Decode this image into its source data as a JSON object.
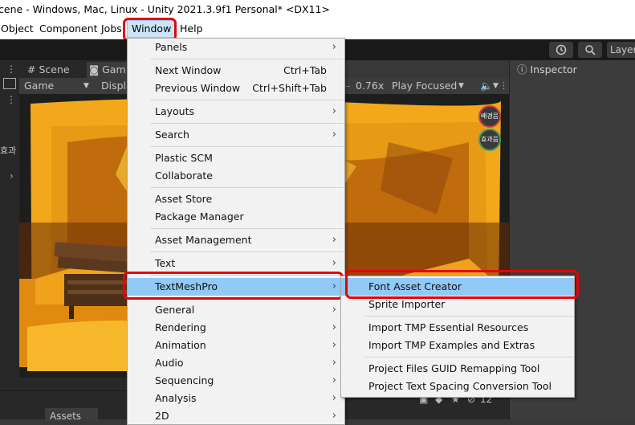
{
  "window_title": "cene - Windows, Mac, Linux - Unity 2021.3.9f1 Personal* <DX11>",
  "menubar": {
    "items": [
      "Object",
      "Component",
      "Jobs",
      "Window",
      "Help"
    ]
  },
  "toolbar": {
    "history_icon": "history-icon",
    "search_icon": "search-icon",
    "layers_label": "Layer"
  },
  "scene_tabs": {
    "scene": "Scene",
    "game": "Gam"
  },
  "game_toolbar": {
    "display_mode": "Game",
    "display_label": "Displa",
    "scale": "0.76x",
    "play_mode": "Play Focused"
  },
  "game_view": {
    "badge_1": "배경음",
    "badge_2": "효과음",
    "left_text": "효과"
  },
  "inspector": {
    "tab_label": "Inspector"
  },
  "bottom": {
    "assets_label": "Assets",
    "count": "12"
  },
  "colors": {
    "highlight": "#91c9f7",
    "annotation": "#e8000b",
    "game_bg": "#d98a12"
  },
  "window_menu": {
    "items": [
      {
        "label": "Panels",
        "submenu": true
      },
      {
        "label": "Next Window",
        "shortcut": "Ctrl+Tab"
      },
      {
        "label": "Previous Window",
        "shortcut": "Ctrl+Shift+Tab"
      },
      {
        "label": "Layouts",
        "submenu": true
      },
      {
        "label": "Search",
        "submenu": true
      },
      {
        "label": "Plastic SCM"
      },
      {
        "label": "Collaborate"
      },
      {
        "label": "Asset Store"
      },
      {
        "label": "Package Manager"
      },
      {
        "label": "Asset Management",
        "submenu": true
      },
      {
        "label": "Text",
        "submenu": true
      },
      {
        "label": "TextMeshPro",
        "submenu": true,
        "highlighted": true
      },
      {
        "label": "General",
        "submenu": true
      },
      {
        "label": "Rendering",
        "submenu": true
      },
      {
        "label": "Animation",
        "submenu": true
      },
      {
        "label": "Audio",
        "submenu": true
      },
      {
        "label": "Sequencing",
        "submenu": true
      },
      {
        "label": "Analysis",
        "submenu": true
      },
      {
        "label": "2D",
        "submenu": true
      }
    ]
  },
  "tmp_submenu": {
    "items": [
      {
        "label": "Font Asset Creator",
        "highlighted": true
      },
      {
        "label": "Sprite Importer"
      },
      {
        "label": "Import TMP Essential Resources"
      },
      {
        "label": "Import TMP Examples and Extras"
      },
      {
        "label": "Project Files GUID Remapping Tool"
      },
      {
        "label": "Project Text Spacing Conversion Tool"
      }
    ]
  }
}
